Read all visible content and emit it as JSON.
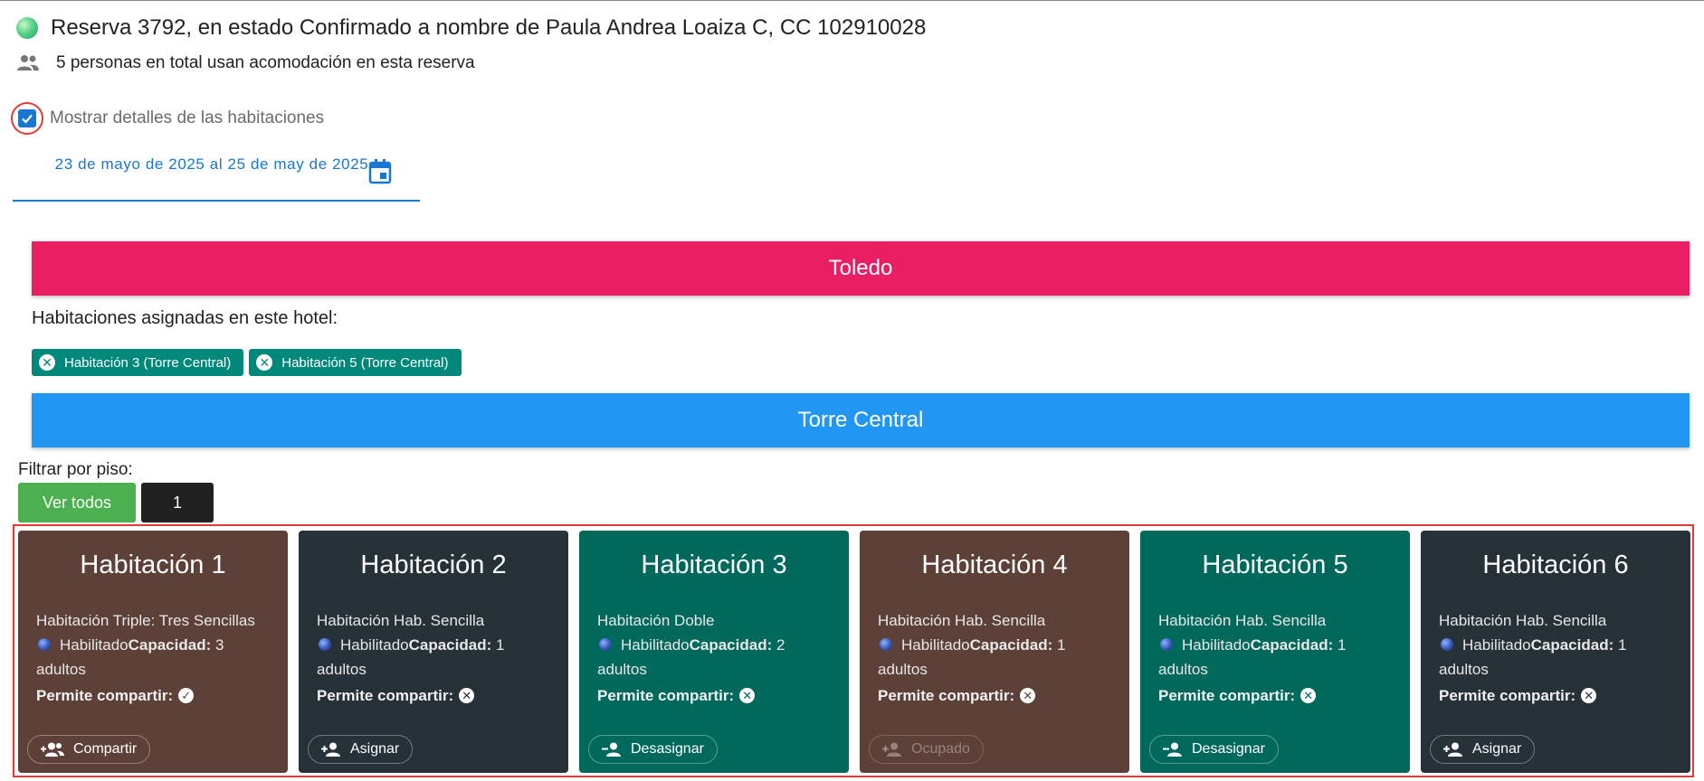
{
  "reservation": {
    "title": "Reserva 3792, en estado Confirmado a nombre de Paula Andrea Loaiza C, CC 102910028",
    "people_text": "5 personas en total usan acomodación en esta reserva"
  },
  "details_toggle": {
    "label": "Mostrar detalles de las habitaciones",
    "checked": true
  },
  "date_range": {
    "text": "23 de mayo de 2025 al 25 de may de 2025"
  },
  "hotel": {
    "name": "Toledo",
    "color": "#e91e63"
  },
  "assigned": {
    "label": "Habitaciones asignadas en este hotel:",
    "chips": [
      {
        "label": "Habitación 3 (Torre Central)"
      },
      {
        "label": "Habitación 5 (Torre Central)"
      }
    ]
  },
  "tower": {
    "name": "Torre Central",
    "color": "#2196f3"
  },
  "floor_filter": {
    "label": "Filtrar por piso:",
    "all_label": "Ver todos",
    "floor_label": "1"
  },
  "rooms": [
    {
      "name": "Habitación 1",
      "type": "Habitación Triple: Tres Sencillas",
      "status": "Habilitado",
      "capacity_label": "Capacidad:",
      "capacity": "3 adultos",
      "share_label": "Permite compartir:",
      "share_symbol": "✓",
      "action": "Compartir",
      "action_icon": "group-add-icon",
      "bg": "#5d4037"
    },
    {
      "name": "Habitación 2",
      "type": "Habitación Hab. Sencilla",
      "status": "Habilitado",
      "capacity_label": "Capacidad:",
      "capacity": "1 adultos",
      "share_label": "Permite compartir:",
      "share_symbol": "✕",
      "action": "Asignar",
      "action_icon": "person-add-icon",
      "bg": "#263238"
    },
    {
      "name": "Habitación 3",
      "type": "Habitación Doble",
      "status": "Habilitado",
      "capacity_label": "Capacidad:",
      "capacity": "2 adultos",
      "share_label": "Permite compartir:",
      "share_symbol": "✕",
      "action": "Desasignar",
      "action_icon": "person-remove-icon",
      "bg": "#00695c"
    },
    {
      "name": "Habitación 4",
      "type": "Habitación Hab. Sencilla",
      "status": "Habilitado",
      "capacity_label": "Capacidad:",
      "capacity": "1 adultos",
      "share_label": "Permite compartir:",
      "share_symbol": "✕",
      "action": "Ocupado",
      "action_icon": "person-add-icon",
      "bg": "#5d4037"
    },
    {
      "name": "Habitación 5",
      "type": "Habitación Hab. Sencilla",
      "status": "Habilitado",
      "capacity_label": "Capacidad:",
      "capacity": "1 adultos",
      "share_label": "Permite compartir:",
      "share_symbol": "✕",
      "action": "Desasignar",
      "action_icon": "person-remove-icon",
      "bg": "#00695c"
    },
    {
      "name": "Habitación 6",
      "type": "Habitación Hab. Sencilla",
      "status": "Habilitado",
      "capacity_label": "Capacidad:",
      "capacity": "1 adultos",
      "share_label": "Permite compartir:",
      "share_symbol": "✕",
      "action": "Asignar",
      "action_icon": "person-add-icon",
      "bg": "#263238"
    }
  ]
}
